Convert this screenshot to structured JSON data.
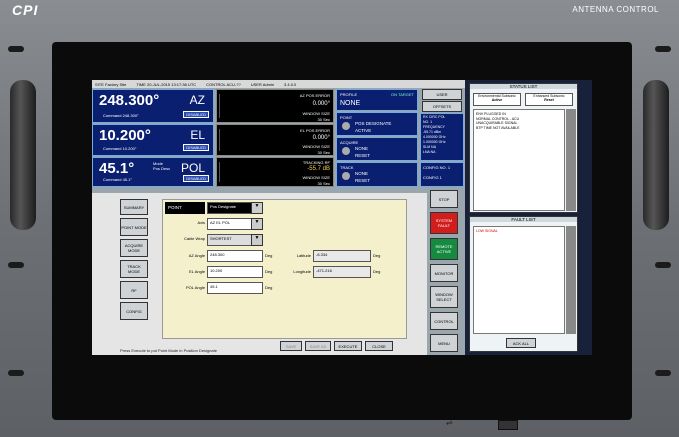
{
  "chassis": {
    "brand": "CPI",
    "model": "ANTENNA CONTROL"
  },
  "topbar": {
    "site": "SITE Factory Site",
    "time": "TIME 20-JUL-2015 13:17:36 UTC",
    "control": "CONTROL ACU-??",
    "user": "USER Admin",
    "version": "3.4.0.0"
  },
  "az": {
    "value": "248.300°",
    "axis": "AZ",
    "cmd_label": "Command",
    "cmd": "248.300°",
    "state": "DISABLED"
  },
  "el": {
    "value": "10.200°",
    "axis": "EL",
    "cmd_label": "Command",
    "cmd": "10.200°",
    "state": "DISABLED"
  },
  "pol": {
    "value": "45.1°",
    "axis": "POL",
    "mode_label": "Mode",
    "mode": "Pos Desc",
    "cmd_label": "Command",
    "cmd": "45.1°",
    "state": "DISABLED"
  },
  "trend_az": {
    "title": "AZ POS ERROR",
    "value": "0.000°",
    "win_label": "WINDOW SIZE",
    "win": "30 Sec"
  },
  "trend_el": {
    "title": "EL POS ERROR",
    "value": "0.000°",
    "win_label": "WINDOW SIZE",
    "win": "30 Sec"
  },
  "trend_trk": {
    "title": "TRACKING RF",
    "value": "-55.7 dB",
    "win_label": "WINDOW SIZE",
    "win": "30 Sec"
  },
  "profile": {
    "label": "PROFILE",
    "value": "NONE",
    "target": "ON TARGET"
  },
  "point": {
    "label": "POINT",
    "mode": "POS DESIGNATE",
    "status": "ACTIVE"
  },
  "acquire": {
    "label": "ACQUIRE",
    "value": "NONE",
    "action": "RESET"
  },
  "track": {
    "label": "TRACK",
    "value": "NONE",
    "action": "RESET"
  },
  "rx": {
    "line1": "RX  CIRC  POL",
    "line2": "NO. 1",
    "line3": "FREQUENCY",
    "line4": "-55.71   dBm",
    "line5": "4.000000  GHz",
    "line6": "1.000000  GHz",
    "line7": "SLM  NA",
    "line8": "LNA  NA"
  },
  "config": {
    "label": "CONFIG NO. 1",
    "name": "CONFIG 1"
  },
  "buttons": {
    "user": "USER",
    "offsets": "OFFSETS",
    "stop": "STOP",
    "system_fault": "SYSTEM FAULT",
    "remote_active": "REMOTE ACTIVE",
    "monitor": "MONITOR",
    "window_select": "WINDOW SELECT",
    "control": "CONTROL",
    "menu": "MENU"
  },
  "nav": [
    "SUMMARY",
    "POINT MODE",
    "ACQUIRE MODE",
    "TRACK MODE",
    "RF",
    "CONFIG"
  ],
  "form": {
    "mode_label": "POINT",
    "mode_value": "Pos Designate",
    "axis_label": "Axis",
    "axis_value": "AZ EL POL",
    "cable_label": "Cable Wrap",
    "cable_value": "SHORTEST",
    "az_label": "AZ Angle",
    "az_value": "248.300",
    "unit": "Deg",
    "el_label": "EL Angle",
    "el_value": "10.200",
    "pol_label": "POL Angle",
    "pol_value": "45.1",
    "lat_label": "Latitude",
    "lat_value": "-6.334",
    "lon_label": "Longitude",
    "lon_value": "-471.216"
  },
  "actions": {
    "save": "SAVE",
    "save_as": "SAVE AS",
    "execute": "EXECUTE",
    "close": "CLOSE"
  },
  "hint": "Press Execute to put Point Mode in Position Designate",
  "status_list": {
    "title": "STATUS LIST",
    "env_label": "Environmental Subsonic",
    "env_value": "Active",
    "enhanced_label": "Enhanced Subsonic",
    "enhanced_value": "Reset",
    "lines": [
      "ENV PLUGGED IN",
      "NORMAL CONTROL - ACU",
      "UNACQUIRABLE SIGNAL",
      "BTP TIME NOT AVAILABLE"
    ]
  },
  "fault_list": {
    "title": "FAULT LIST",
    "lines": [
      "LOW SIGNAL"
    ],
    "ack_label": "ACK ALL"
  }
}
